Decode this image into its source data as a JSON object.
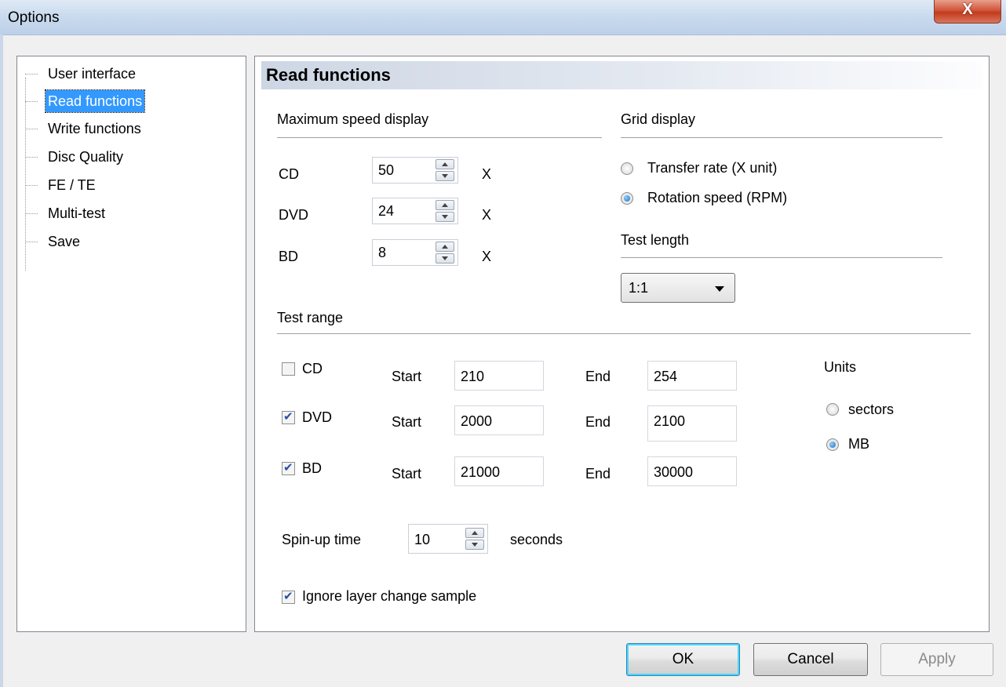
{
  "window": {
    "title": "Options",
    "close_label": "X"
  },
  "tree": {
    "items": [
      {
        "label": "User interface"
      },
      {
        "label": "Read functions",
        "selected": true
      },
      {
        "label": "Write functions"
      },
      {
        "label": "Disc Quality"
      },
      {
        "label": "FE / TE"
      },
      {
        "label": "Multi-test"
      },
      {
        "label": "Save"
      }
    ]
  },
  "panel": {
    "title": "Read functions",
    "max_speed": {
      "heading": "Maximum speed display",
      "rows": [
        {
          "label": "CD",
          "value": "50",
          "unit": "X"
        },
        {
          "label": "DVD",
          "value": "24",
          "unit": "X"
        },
        {
          "label": "BD",
          "value": "8",
          "unit": "X"
        }
      ]
    },
    "grid_display": {
      "heading": "Grid display",
      "options": [
        {
          "label": "Transfer rate (X unit)",
          "selected": false
        },
        {
          "label": "Rotation speed (RPM)",
          "selected": true
        }
      ]
    },
    "test_length": {
      "heading": "Test length",
      "value": "1:1"
    },
    "test_range": {
      "heading": "Test range",
      "start_label": "Start",
      "end_label": "End",
      "rows": [
        {
          "label": "CD",
          "checked": false,
          "start": "210",
          "end": "254"
        },
        {
          "label": "DVD",
          "checked": true,
          "start": "2000",
          "end": "2100"
        },
        {
          "label": "BD",
          "checked": true,
          "start": "21000",
          "end": "30000"
        }
      ]
    },
    "units": {
      "heading": "Units",
      "options": [
        {
          "label": "sectors",
          "selected": false
        },
        {
          "label": "MB",
          "selected": true
        }
      ]
    },
    "spin_up": {
      "label": "Spin-up time",
      "value": "10",
      "unit": "seconds"
    },
    "ignore_layer": {
      "label": "Ignore layer change sample",
      "checked": true
    }
  },
  "buttons": {
    "ok": "OK",
    "cancel": "Cancel",
    "apply": "Apply"
  }
}
